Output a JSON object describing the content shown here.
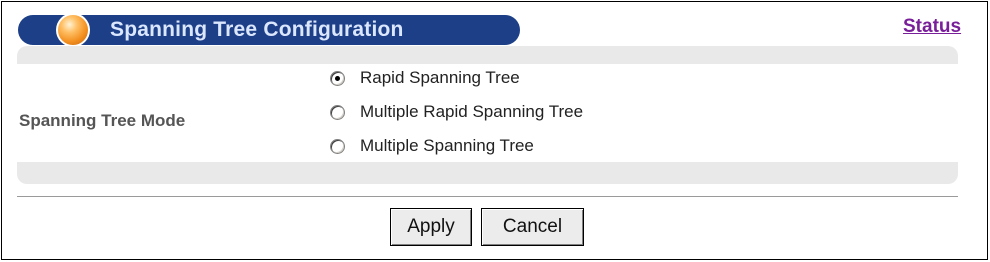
{
  "header": {
    "title": "Spanning Tree Configuration",
    "status_link": "Status",
    "colors": {
      "title_bar": "#1c3f87",
      "title_text": "#dbe6ff",
      "orb": "#f39020",
      "link": "#7a1f9a"
    }
  },
  "form": {
    "field_label": "Spanning Tree Mode",
    "mode_options": [
      {
        "label": "Rapid Spanning Tree",
        "checked": true
      },
      {
        "label": "Multiple Rapid Spanning Tree",
        "checked": false
      },
      {
        "label": "Multiple Spanning Tree",
        "checked": false
      }
    ]
  },
  "actions": {
    "apply_label": "Apply",
    "cancel_label": "Cancel"
  },
  "icons": {
    "title_orb": "orb-icon",
    "radio": "radio-button-icon"
  }
}
